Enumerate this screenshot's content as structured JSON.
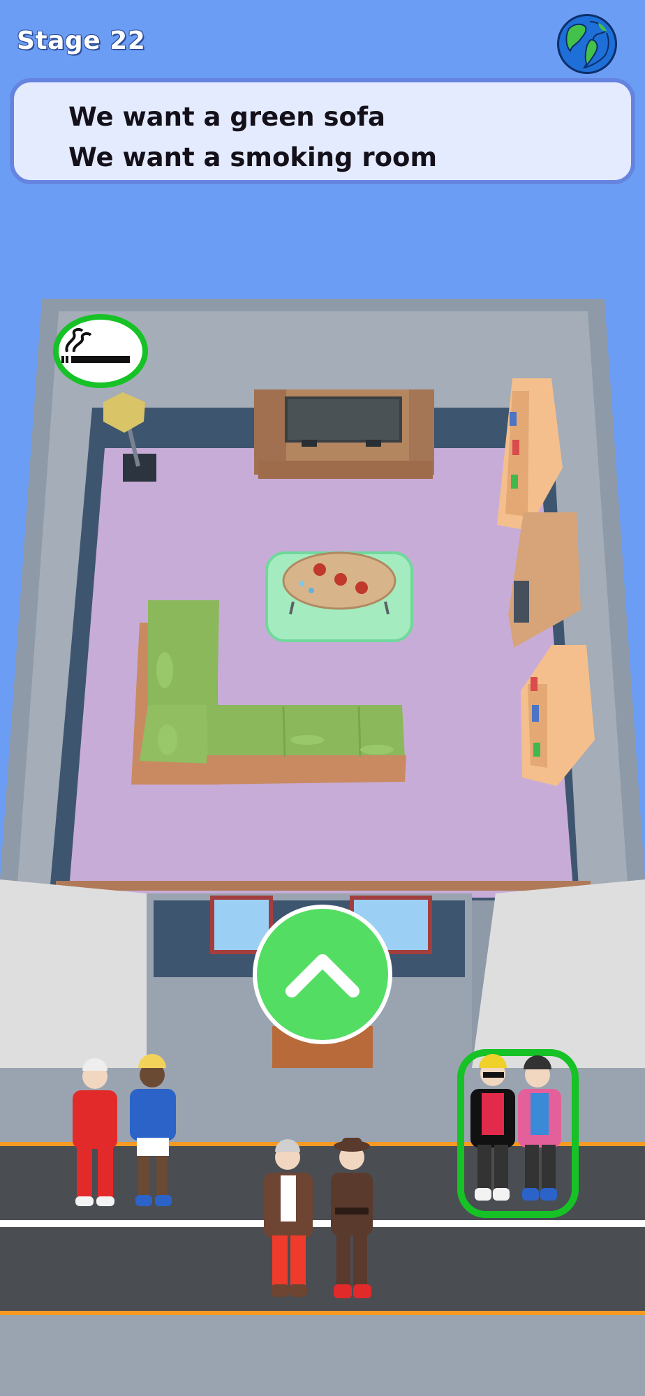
{
  "header": {
    "stage_label": "Stage 22",
    "globe_icon": "globe-icon"
  },
  "requests": [
    "We want a green sofa",
    "We want a smoking room"
  ],
  "room": {
    "badge_icon": "smoking-icon",
    "floor_color": "#c8acd8",
    "sofa_color": "#8ab85a"
  },
  "controls": {
    "up_button_icon": "chevron-up-icon"
  },
  "colors": {
    "sky": "#6b9df5",
    "panel_bg": "#e4ebff",
    "panel_border": "#6584e0",
    "accept_green": "#54dd63",
    "highlight_green": "#16c226"
  }
}
